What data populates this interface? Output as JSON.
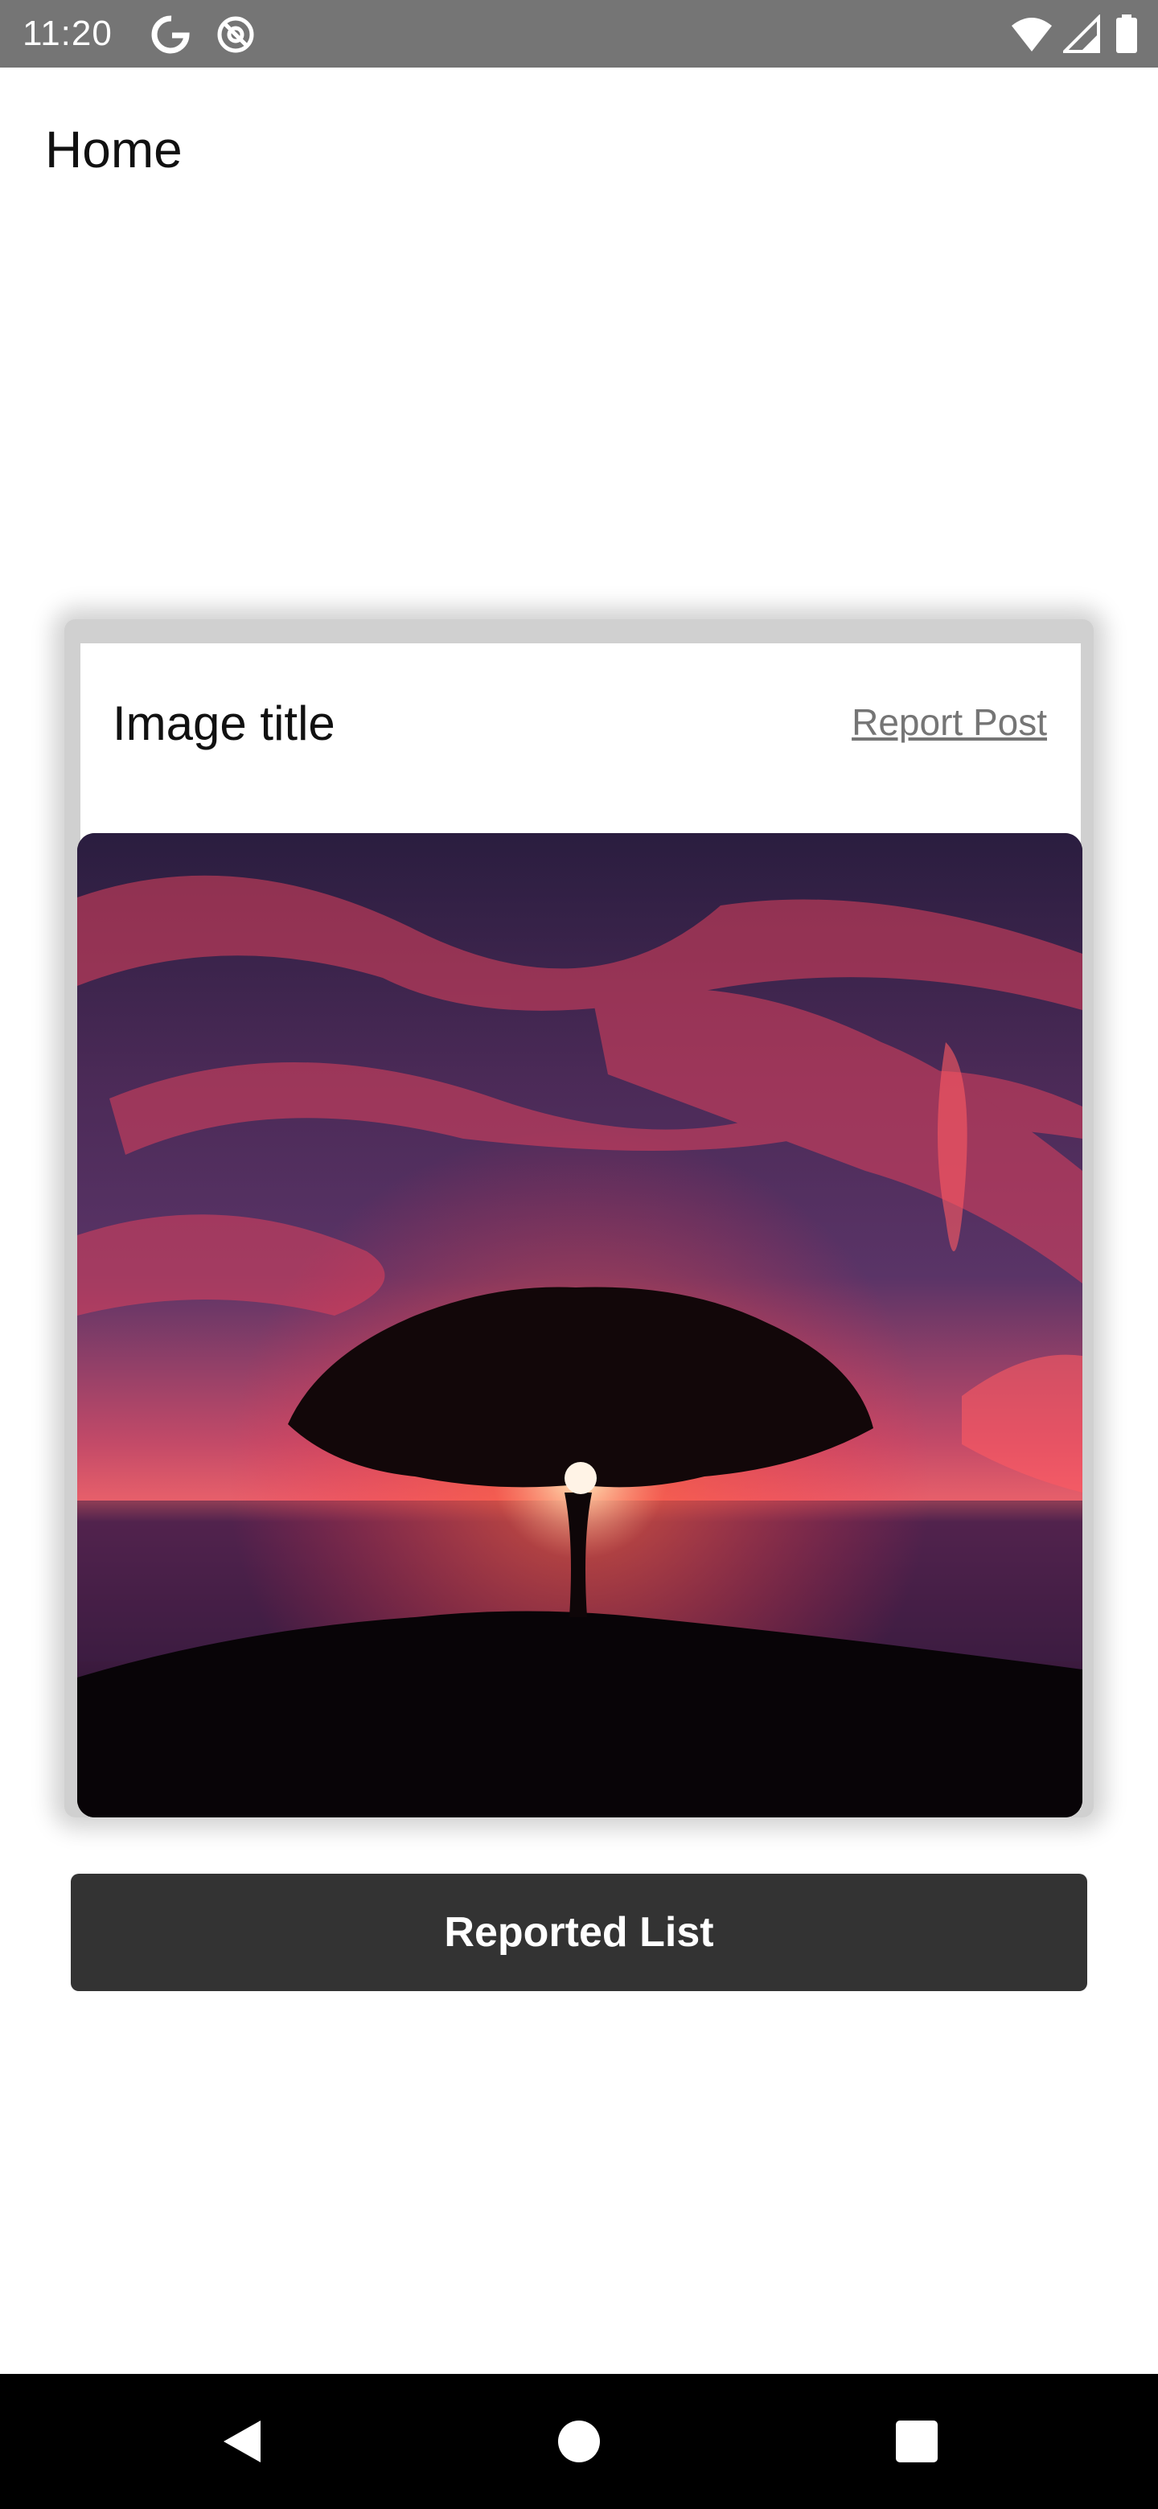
{
  "status_bar": {
    "time": "11:20",
    "left_icons": [
      "google-g-icon",
      "at-sign-icon"
    ],
    "right_icons": [
      "wifi-icon",
      "signal-icon",
      "battery-icon"
    ],
    "background": "#757575"
  },
  "app_bar": {
    "title": "Home"
  },
  "post_card": {
    "title": "Image title",
    "report_label": "Report Post",
    "image_icon": "sunset-tree-image"
  },
  "actions": {
    "reported_list_label": "Reported List",
    "button_color": "#333333"
  },
  "nav_bar": {
    "icons": [
      "back-icon",
      "home-icon",
      "recents-icon"
    ]
  }
}
